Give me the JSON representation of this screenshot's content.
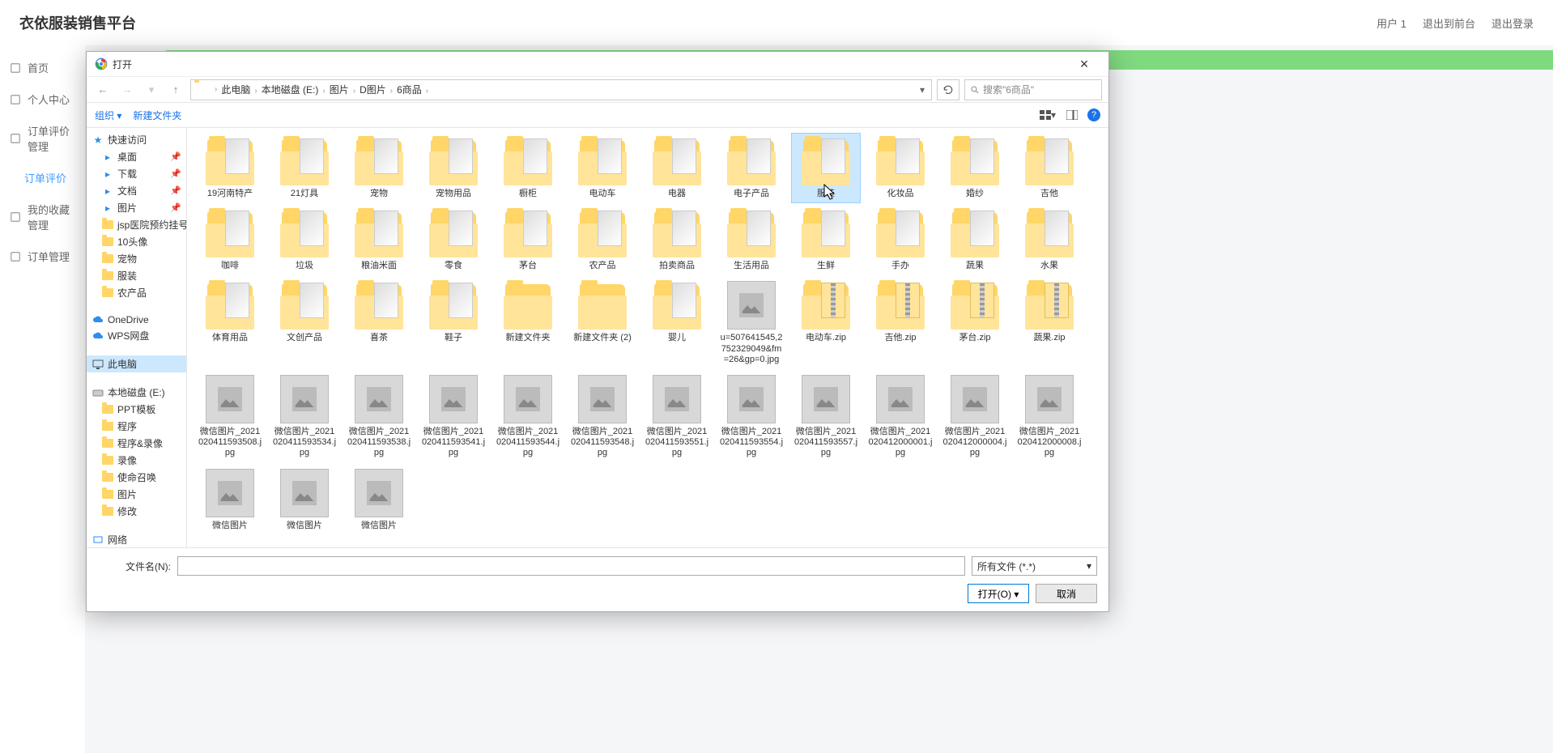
{
  "page": {
    "logo": "衣依服装销售平台",
    "top_right": {
      "user": "用户 1",
      "front": "退出到前台",
      "logout": "退出登录"
    },
    "sidebar": [
      {
        "icon": "home",
        "label": "首页"
      },
      {
        "icon": "user",
        "label": "个人中心"
      },
      {
        "icon": "list",
        "label": "订单评价管理"
      },
      {
        "icon": "",
        "label": "订单评价",
        "active": true
      },
      {
        "icon": "list",
        "label": "我的收藏管理"
      },
      {
        "icon": "doc",
        "label": "订单管理"
      }
    ]
  },
  "dialog": {
    "title": "打开",
    "breadcrumbs": [
      "此电脑",
      "本地磁盘 (E:)",
      "图片",
      "D图片",
      "6商品"
    ],
    "search_placeholder": "搜索\"6商品\"",
    "toolbar": {
      "organize": "组织",
      "new_folder": "新建文件夹"
    },
    "tree": {
      "quick_access": "快速访问",
      "quick_items": [
        "桌面",
        "下载",
        "文档",
        "图片",
        "jsp医院预约挂号",
        "10头像",
        "宠物",
        "服装",
        "农产品"
      ],
      "onedrive": "OneDrive",
      "wps": "WPS网盘",
      "this_pc": "此电脑",
      "local_disk": "本地磁盘 (E:)",
      "disk_items": [
        "PPT模板",
        "程序",
        "程序&录像",
        "录像",
        "使命召唤",
        "图片",
        "修改"
      ],
      "network": "网络"
    },
    "items_row1": [
      {
        "type": "folder",
        "name": "19河南特产"
      },
      {
        "type": "folder",
        "name": "21灯具"
      },
      {
        "type": "folder",
        "name": "宠物"
      },
      {
        "type": "folder",
        "name": "宠物用品"
      },
      {
        "type": "folder",
        "name": "橱柜"
      },
      {
        "type": "folder",
        "name": "电动车"
      },
      {
        "type": "folder",
        "name": "电器"
      },
      {
        "type": "folder",
        "name": "电子产品"
      },
      {
        "type": "folder",
        "name": "服装",
        "selected": true
      },
      {
        "type": "folder",
        "name": "化妆品"
      },
      {
        "type": "folder",
        "name": "婚纱"
      },
      {
        "type": "folder",
        "name": "吉他"
      }
    ],
    "items_row2": [
      {
        "type": "folder",
        "name": "咖啡"
      },
      {
        "type": "folder",
        "name": "垃圾"
      },
      {
        "type": "folder",
        "name": "粮油米面"
      },
      {
        "type": "folder",
        "name": "零食"
      },
      {
        "type": "folder",
        "name": "茅台"
      },
      {
        "type": "folder",
        "name": "农产品"
      },
      {
        "type": "folder",
        "name": "拍卖商品"
      },
      {
        "type": "folder",
        "name": "生活用品"
      },
      {
        "type": "folder",
        "name": "生鲜"
      },
      {
        "type": "folder",
        "name": "手办"
      },
      {
        "type": "folder",
        "name": "蔬果"
      },
      {
        "type": "folder",
        "name": "水果"
      }
    ],
    "items_row3": [
      {
        "type": "folder",
        "name": "体育用品"
      },
      {
        "type": "folder",
        "name": "文创产品"
      },
      {
        "type": "folder",
        "name": "喜茶"
      },
      {
        "type": "folder",
        "name": "鞋子"
      },
      {
        "type": "folder-plain",
        "name": "新建文件夹"
      },
      {
        "type": "folder-plain",
        "name": "新建文件夹 (2)"
      },
      {
        "type": "folder",
        "name": "婴儿"
      },
      {
        "type": "img",
        "name": "u=507641545,2752329049&fm=26&gp=0.jpg"
      },
      {
        "type": "zip",
        "name": "电动车.zip"
      },
      {
        "type": "zip",
        "name": "吉他.zip"
      },
      {
        "type": "zip",
        "name": "茅台.zip"
      },
      {
        "type": "zip",
        "name": "蔬果.zip"
      }
    ],
    "items_row4": [
      {
        "type": "img",
        "name": "微信图片_2021020411593508.jpg"
      },
      {
        "type": "img",
        "name": "微信图片_2021020411593534.jpg"
      },
      {
        "type": "img",
        "name": "微信图片_2021020411593538.jpg"
      },
      {
        "type": "img",
        "name": "微信图片_2021020411593541.jpg"
      },
      {
        "type": "img",
        "name": "微信图片_2021020411593544.jpg"
      },
      {
        "type": "img",
        "name": "微信图片_2021020411593548.jpg"
      },
      {
        "type": "img",
        "name": "微信图片_2021020411593551.jpg"
      },
      {
        "type": "img",
        "name": "微信图片_2021020411593554.jpg"
      },
      {
        "type": "img",
        "name": "微信图片_2021020411593557.jpg"
      },
      {
        "type": "img",
        "name": "微信图片_2021020412000001.jpg"
      },
      {
        "type": "img",
        "name": "微信图片_2021020412000004.jpg"
      },
      {
        "type": "img",
        "name": "微信图片_2021020412000008.jpg"
      }
    ],
    "items_row5": [
      {
        "type": "img",
        "name": "微信图片"
      },
      {
        "type": "img",
        "name": "微信图片"
      },
      {
        "type": "img",
        "name": "微信图片"
      }
    ],
    "filename_label": "文件名(N):",
    "filetype_label": "所有文件 (*.*)",
    "open_btn": "打开(O)",
    "cancel_btn": "取消"
  }
}
